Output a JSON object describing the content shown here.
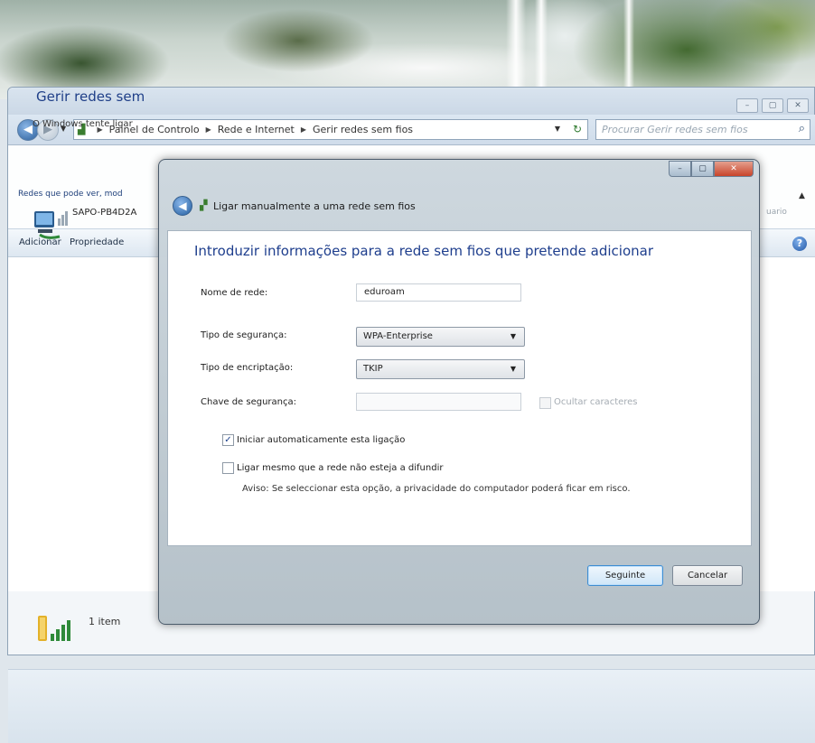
{
  "explorer": {
    "breadcrumb": [
      "Painel de Controlo",
      "Rede e Internet",
      "Gerir redes sem fios"
    ],
    "search_placeholder": "Procurar Gerir redes sem fios",
    "page_title": "Gerir redes sem",
    "page_subtitle": "O Windows tente ligar",
    "toolbar": {
      "add_label": "Adicionar",
      "properties_label": "Propriedade"
    },
    "list_header": "Redes que pode ver, mod",
    "networks": [
      {
        "name": "SAPO-PB4D2A"
      }
    ],
    "right_hint": "uario",
    "status_text": "1 item"
  },
  "dialog": {
    "title": "Ligar manualmente a uma rede sem fios",
    "heading": "Introduzir informações para a rede sem fios que pretende adicionar",
    "fields": {
      "network_name_label": "Nome de rede:",
      "network_name_value": "eduroam",
      "security_type_label": "Tipo de segurança:",
      "security_type_value": "WPA-Enterprise",
      "encryption_type_label": "Tipo de encriptação:",
      "encryption_type_value": "TKIP",
      "security_key_label": "Chave de segurança:",
      "security_key_value": "",
      "hide_chars_label": "Ocultar caracteres"
    },
    "options": {
      "auto_start_label": "Iniciar automaticamente esta ligação",
      "auto_start_checked": true,
      "connect_hidden_label": "Ligar mesmo que a rede não esteja a difundir",
      "connect_hidden_checked": false
    },
    "warning": "Aviso: Se seleccionar esta opção, a privacidade do computador poderá ficar em risco.",
    "buttons": {
      "next_label": "Seguinte",
      "cancel_label": "Cancelar"
    }
  },
  "icons": {
    "back": "back-arrow-icon",
    "forward": "forward-arrow-icon",
    "refresh": "refresh-icon",
    "search": "search-icon",
    "help": "help-icon",
    "network": "wireless-network-icon"
  }
}
